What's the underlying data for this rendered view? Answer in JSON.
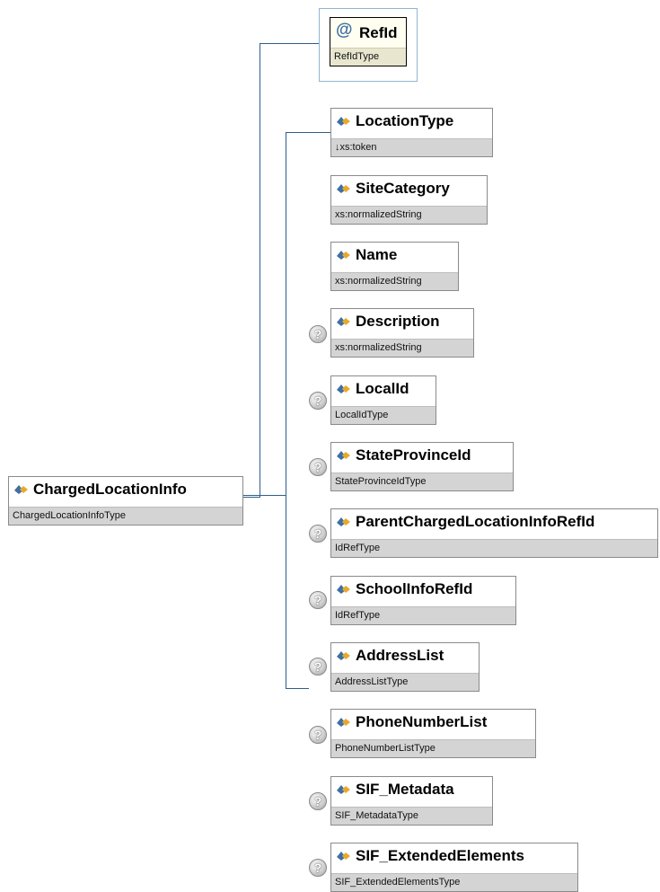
{
  "root": {
    "name": "ChargedLocationInfo",
    "type": "ChargedLocationInfoType"
  },
  "attribute": {
    "name": "RefId",
    "type": "RefIdType",
    "icon": "at-sign-icon"
  },
  "elements": [
    {
      "name": "LocationType",
      "type": "↓xs:token",
      "optional": false
    },
    {
      "name": "SiteCategory",
      "type": "xs:normalizedString",
      "optional": false
    },
    {
      "name": "Name",
      "type": "xs:normalizedString",
      "optional": false
    },
    {
      "name": "Description",
      "type": "xs:normalizedString",
      "optional": true
    },
    {
      "name": "LocalId",
      "type": "LocalIdType",
      "optional": true
    },
    {
      "name": "StateProvinceId",
      "type": "StateProvinceIdType",
      "optional": true
    },
    {
      "name": "ParentChargedLocationInfoRefId",
      "type": "IdRefType",
      "optional": true
    },
    {
      "name": "SchoolInfoRefId",
      "type": "IdRefType",
      "optional": true
    },
    {
      "name": "AddressList",
      "type": "AddressListType",
      "optional": true
    },
    {
      "name": "PhoneNumberList",
      "type": "PhoneNumberListType",
      "optional": true
    },
    {
      "name": "SIF_Metadata",
      "type": "SIF_MetadataType",
      "optional": true
    },
    {
      "name": "SIF_ExtendedElements",
      "type": "SIF_ExtendedElementsType",
      "optional": true
    }
  ],
  "optional_marker": "?",
  "colors": {
    "connector": "#2f5e8c",
    "icon": "#3f6fa3",
    "type_band": "#d4d4d4"
  }
}
